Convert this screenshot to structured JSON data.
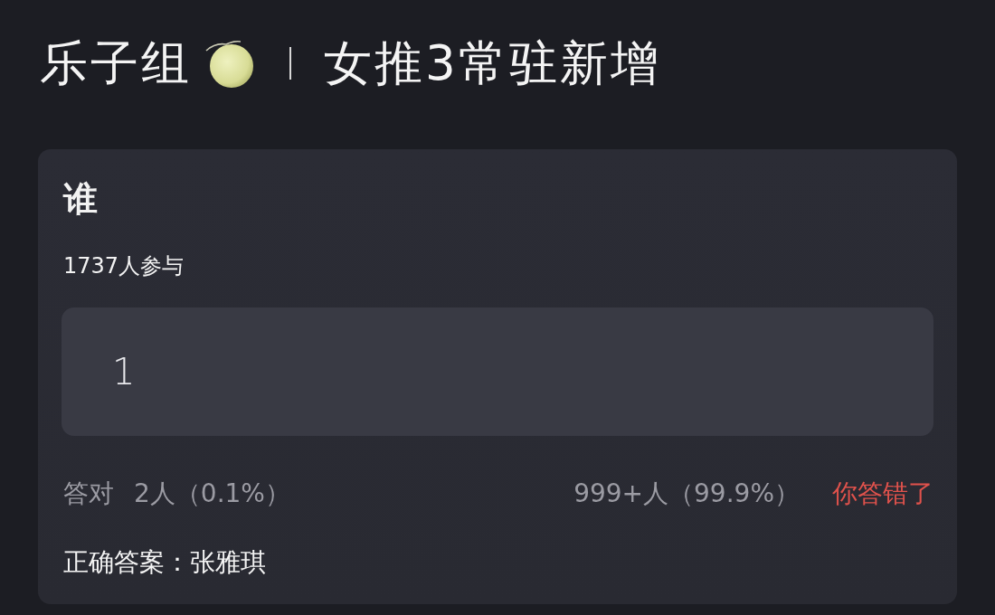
{
  "header": {
    "group": "乐子组",
    "title": "女推3常驻新增"
  },
  "quiz": {
    "question": "谁",
    "participants": "1737人参与",
    "answer": {
      "value": "1"
    },
    "stats": {
      "correct_label": "答对",
      "correct_count": "2人（0.1%）",
      "wrong_count": "999+人（99.9%）",
      "result": {
        "text": "你答错了",
        "correct": false
      }
    },
    "correct_answer": "正确答案：张雅琪"
  }
}
